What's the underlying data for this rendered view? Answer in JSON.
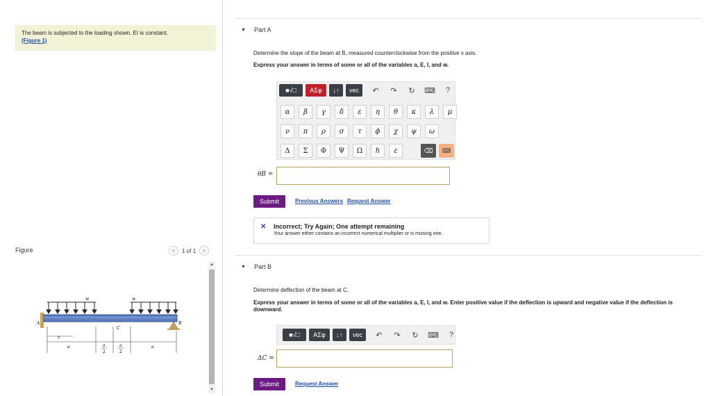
{
  "problem": {
    "statement": "The beam is subjected to the loading shown. EI is constant.",
    "figure_link": "(Figure 1)"
  },
  "figure_panel": {
    "title": "Figure",
    "pager": {
      "prev": "<",
      "label": "1 of 1",
      "next": ">"
    },
    "labels": {
      "w_left": "w",
      "w_right": "w",
      "A": "A",
      "B": "B",
      "C": "C",
      "x": "x",
      "a_left": "a",
      "a_half_num": "a",
      "a_half_den": "2",
      "a_half2_num": "a",
      "a_half2_den": "2",
      "a_right": "a"
    }
  },
  "partA": {
    "title": "Part A",
    "question": "Determine the slope of the beam at B, measured counterclockwise from the positive x axis.",
    "instructions": "Express your answer in terms of some or all of the variables a, E, I, and w.",
    "toolbar": {
      "templates": "■√□",
      "greek": "ΑΣφ",
      "sort": "↓↑",
      "vec": "vec",
      "undo": "↶",
      "redo": "↷",
      "reset": "↻",
      "keyboard": "⌨",
      "help": "?"
    },
    "palette_row1": [
      "α",
      "β",
      "γ",
      "δ",
      "ε",
      "η",
      "θ",
      "κ",
      "λ",
      "μ"
    ],
    "palette_row2": [
      "ν",
      "π",
      "ρ",
      "σ",
      "τ",
      "ϕ",
      "χ",
      "ψ",
      "ω"
    ],
    "palette_row3": [
      "Δ",
      "Σ",
      "Φ",
      "Ψ",
      "Ω",
      "ℏ",
      "ε"
    ],
    "answer_label": "θB =",
    "answer_value": "",
    "submit": "Submit",
    "previous_answers": "Previous Answers",
    "request_answer": "Request Answer",
    "feedback": {
      "heading": "Incorrect; Try Again; One attempt remaining",
      "message": "Your answer either contains an incorrect numerical multiplier or is missing one."
    }
  },
  "partB": {
    "title": "Part B",
    "question": "Determine deflection of the beam at C.",
    "instructions": "Express your answer in terms of some or all of the variables a, E, I, and w. Enter positive value if the deflection is upward and negative value if the deflection is downward.",
    "toolbar": {
      "templates": "■√□",
      "greek": "ΑΣφ",
      "sort": "↓↑",
      "vec": "vec",
      "undo": "↶",
      "redo": "↷",
      "reset": "↻",
      "keyboard": "⌨",
      "help": "?"
    },
    "answer_label": "ΔC =",
    "answer_value": "",
    "submit": "Submit",
    "request_answer": "Request Answer"
  },
  "colors": {
    "submit": "#6b1b82",
    "greek_button": "#c0202a",
    "dark_button": "#3a3f46",
    "link": "#1f4fa8",
    "problem_bg": "#f2f3d6"
  }
}
